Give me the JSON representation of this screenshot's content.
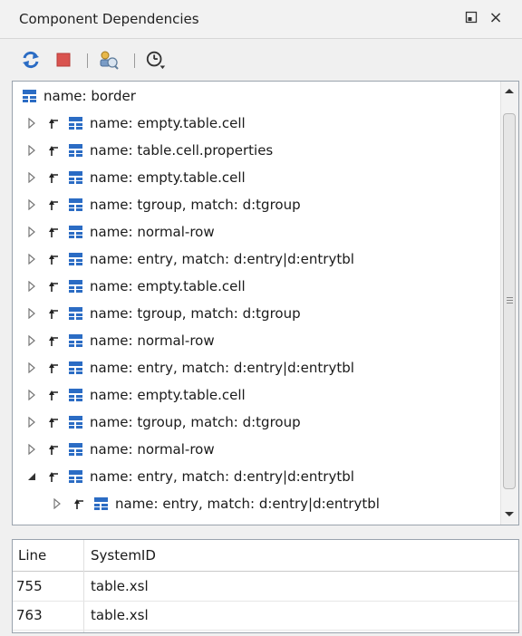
{
  "window": {
    "title": "Component Dependencies",
    "restore_icon": "restore-icon",
    "close_glyph": "×"
  },
  "toolbar": {
    "refresh_icon": "refresh-icon",
    "stop_icon": "stop-icon",
    "configure_icon": "configure-search-icon",
    "history_icon": "history-icon"
  },
  "tree": {
    "rows": [
      {
        "label": "name: border",
        "level": 0,
        "expander": "none"
      },
      {
        "label": "name: empty.table.cell",
        "level": 1,
        "expander": "collapsed"
      },
      {
        "label": "name: table.cell.properties",
        "level": 1,
        "expander": "collapsed"
      },
      {
        "label": "name: empty.table.cell",
        "level": 1,
        "expander": "collapsed"
      },
      {
        "label": "name: tgroup,  match: d:tgroup",
        "level": 1,
        "expander": "collapsed"
      },
      {
        "label": "name: normal-row",
        "level": 1,
        "expander": "collapsed"
      },
      {
        "label": "name: entry,  match: d:entry|d:entrytbl",
        "level": 1,
        "expander": "collapsed"
      },
      {
        "label": "name: empty.table.cell",
        "level": 1,
        "expander": "collapsed"
      },
      {
        "label": "name: tgroup,  match: d:tgroup",
        "level": 1,
        "expander": "collapsed"
      },
      {
        "label": "name: normal-row",
        "level": 1,
        "expander": "collapsed"
      },
      {
        "label": "name: entry,  match: d:entry|d:entrytbl",
        "level": 1,
        "expander": "collapsed"
      },
      {
        "label": "name: empty.table.cell",
        "level": 1,
        "expander": "collapsed"
      },
      {
        "label": "name: tgroup,  match: d:tgroup",
        "level": 1,
        "expander": "collapsed"
      },
      {
        "label": "name: normal-row",
        "level": 1,
        "expander": "collapsed"
      },
      {
        "label": "name: entry,  match: d:entry|d:entrytbl",
        "level": 1,
        "expander": "expanded"
      },
      {
        "label": "name: entry,  match: d:entry|d:entrytbl",
        "level": 2,
        "expander": "collapsed"
      },
      {
        "label": "name: entry,  match: d:entry|d:entrytbl",
        "level": 2,
        "expander": "collapsed"
      }
    ]
  },
  "table": {
    "columns": [
      "Line",
      "SystemID"
    ],
    "rows": [
      {
        "line": "755",
        "system_id": "table.xsl"
      },
      {
        "line": "763",
        "system_id": "table.xsl"
      }
    ]
  },
  "colors": {
    "node_icon": "#2b6cc4",
    "arrow_icon": "#222222",
    "stop": "#d9534f"
  }
}
